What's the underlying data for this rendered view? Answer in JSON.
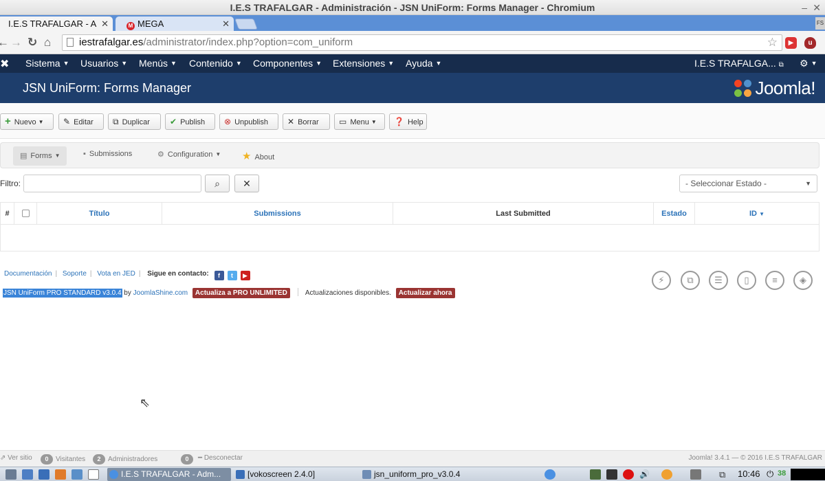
{
  "window": {
    "title": "I.E.S TRAFALGAR - Administración - JSN UniForm: Forms Manager - Chromium",
    "min_btn": "–",
    "close_btn": "✕"
  },
  "tabs": [
    {
      "label": "I.E.S TRAFALGAR - A",
      "close": "✕"
    },
    {
      "label": "MEGA",
      "close": "✕"
    }
  ],
  "address": {
    "host": "iestrafalgar.es",
    "path": "/administrator/index.php?option=com_uniform"
  },
  "extensions": [
    "FS"
  ],
  "adminnav": {
    "logo": "✖",
    "items": [
      "Sistema",
      "Usuarios",
      "Menús",
      "Contenido",
      "Componentes",
      "Extensiones",
      "Ayuda"
    ],
    "site_name": "I.E.S TRAFALGA...",
    "settings_icon": "gear-icon"
  },
  "header": {
    "title": "JSN UniForm: Forms Manager",
    "brand": "Joomla!"
  },
  "toolbar": [
    "Nuevo",
    "Editar",
    "Duplicar",
    "Publish",
    "Unpublish",
    "Borrar",
    "Menu",
    "Help"
  ],
  "subnav": [
    "Forms",
    "Submissions",
    "Configuration",
    "About"
  ],
  "filter": {
    "label": "Filtro:",
    "value": "",
    "state_placeholder": "- Seleccionar Estado -"
  },
  "table": {
    "columns": [
      "#",
      "Título",
      "Submissions",
      "Last Submitted",
      "Estado",
      "ID"
    ],
    "rows": []
  },
  "footer_links": [
    "Documentación",
    "Soporte",
    "Vota en JED"
  ],
  "contact_label": "Sigue en contacto:",
  "promo": {
    "product": "JSN UniForm PRO STANDARD v3.0.4",
    "by": "by",
    "vendor": "JoomlaShine.com",
    "upgrade": "Actualiza a PRO UNLIMITED",
    "updates": "Actualizaciones disponibles.",
    "update_now": "Actualizar ahora"
  },
  "status": {
    "view_site": "Ver sitio",
    "visitors_count": "0",
    "visitors_label": "Visitantes",
    "admins_count": "2",
    "admins_label": "Administradores",
    "messages_count": "0",
    "logout": "Desconectar",
    "copyright": "Joomla! 3.4.1  —  © 2016 I.E.S TRAFALGAR"
  },
  "taskbar": {
    "tasks": [
      "I.E.S TRAFALGAR - Adm...",
      "[vokoscreen 2.4.0]",
      "jsn_uniform_pro_v3.0.4"
    ],
    "clock": "10:46",
    "battery": "38"
  },
  "colors": {
    "navbar": "#172c4c",
    "header": "#1e3e6c",
    "link": "#2b72b8",
    "pill": "#9a3432",
    "tabstrip": "#5b8fd6"
  }
}
